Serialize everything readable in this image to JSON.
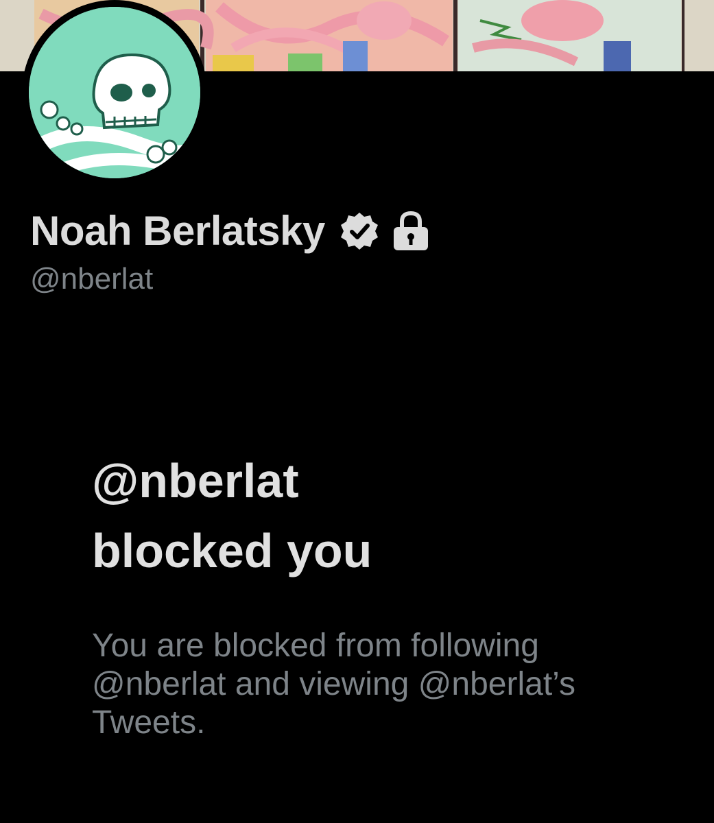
{
  "profile": {
    "display_name": "Noah Berlatsky",
    "handle": "@nberlat",
    "verified_icon": "verified-badge-icon",
    "protected_icon": "lock-icon",
    "banner": "comic-art-banner",
    "avatar": "skull-and-bones-avatar"
  },
  "blocked": {
    "title_line1": "@nberlat",
    "title_line2": "blocked you",
    "description": "You are blocked from following @nberlat and viewing @nberlat’s Tweets."
  },
  "colors": {
    "background": "#000000",
    "primary_text": "#e7e9ea",
    "secondary_text": "#7e8489",
    "avatar_bg": "#7fd9bb"
  }
}
